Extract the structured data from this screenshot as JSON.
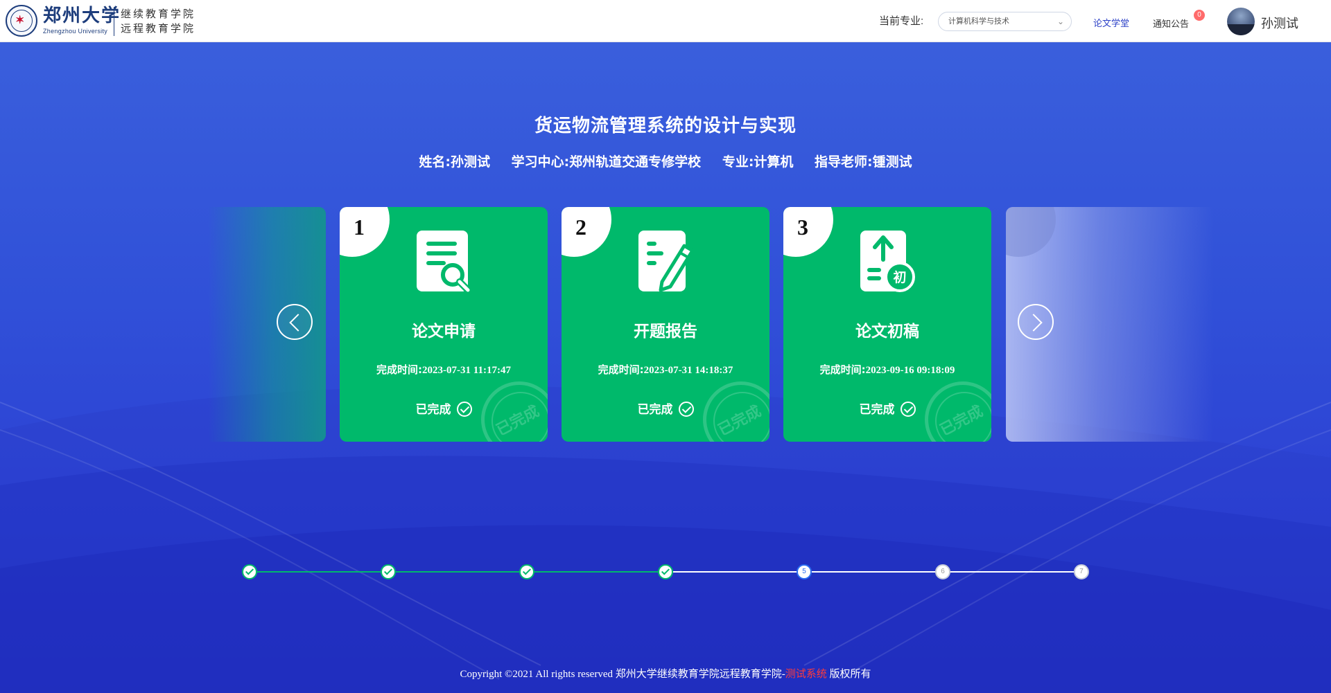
{
  "header": {
    "logo": {
      "name_cn": "郑州大学",
      "name_en": "Zhengzhou University",
      "college_line1": "继续教育学院",
      "college_line2": "远程教育学院"
    },
    "major_label": "当前专业:",
    "major_select": {
      "value": "计算机科学与技术"
    },
    "nav_thesis": "论文学堂",
    "nav_notice": "通知公告",
    "notice_badge": "0",
    "user_name": "孙测试"
  },
  "thesis": {
    "title": "货运物流管理系统的设计与实现",
    "meta": {
      "name": "姓名:孙测试",
      "center": "学习中心:郑州轨道交通专修学校",
      "major": "专业:计算机",
      "advisor": "指导老师:锺测试"
    }
  },
  "cards": [
    {
      "number": "1",
      "title": "论文申请",
      "time_label": "完成时间:",
      "time": "2023-07-31 11:17:47",
      "status": "已完成",
      "stamp": "已完成",
      "icon": "document-search-icon"
    },
    {
      "number": "2",
      "title": "开题报告",
      "time_label": "完成时间:",
      "time": "2023-07-31 14:18:37",
      "status": "已完成",
      "stamp": "已完成",
      "icon": "edit-pencil-icon"
    },
    {
      "number": "3",
      "title": "论文初稿",
      "time_label": "完成时间:",
      "time": "2023-09-16 09:18:09",
      "status": "已完成",
      "stamp": "已完成",
      "icon": "upload-draft-icon"
    }
  ],
  "progress": {
    "steps": [
      {
        "label": "",
        "state": "done"
      },
      {
        "label": "",
        "state": "done"
      },
      {
        "label": "",
        "state": "done"
      },
      {
        "label": "",
        "state": "done"
      },
      {
        "label": "5",
        "state": "current"
      },
      {
        "label": "6",
        "state": "todo"
      },
      {
        "label": "7",
        "state": "todo"
      }
    ],
    "completed_fraction": 0.5
  },
  "footer": {
    "copyright": "Copyright ©2021 All rights reserved 郑州大学继续教育学院远程教育学院-",
    "test_system": "测试系统",
    "suffix": " 版权所有"
  },
  "colors": {
    "card_green": "#00b96b",
    "hero_blue": "#3050d8",
    "accent_blue": "#2a3fc6",
    "badge_red": "#ff6b6b",
    "footer_red": "#ff3b3b"
  }
}
